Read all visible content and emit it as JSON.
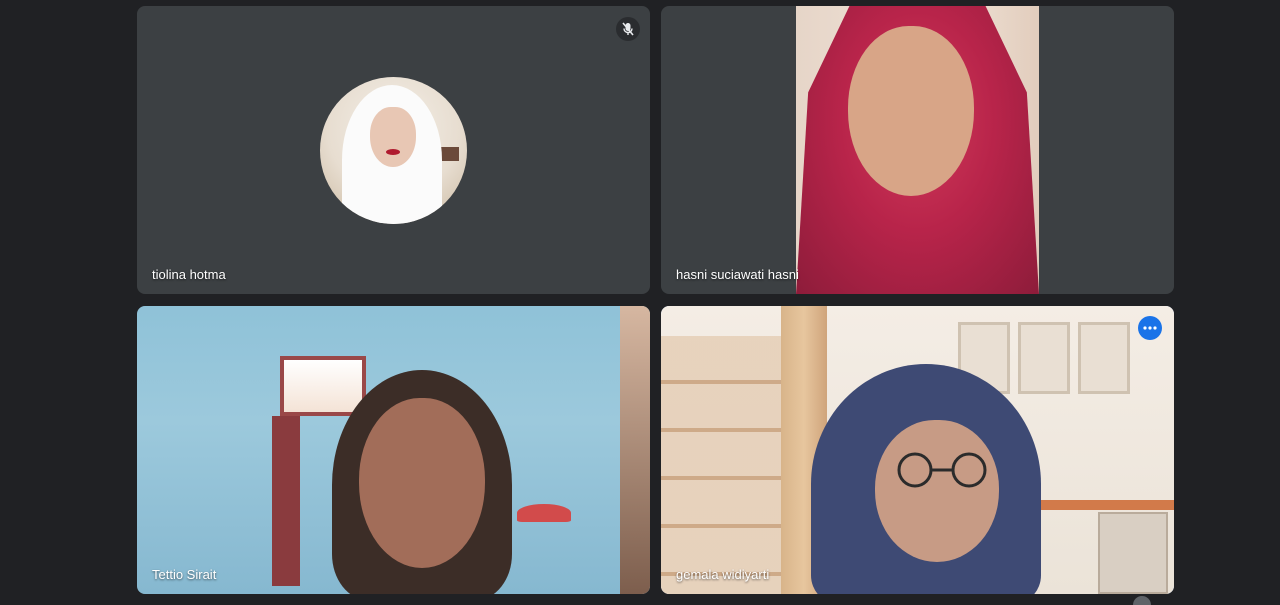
{
  "participants": [
    {
      "name": "tiolina hotma",
      "muted": true,
      "video_on": false
    },
    {
      "name": "hasni suciawati hasni",
      "muted": false,
      "video_on": true
    },
    {
      "name": "Tettio Sirait",
      "muted": false,
      "video_on": true
    },
    {
      "name": "gemala widiyarti",
      "muted": false,
      "video_on": true,
      "active_speaker": true
    }
  ],
  "icons": {
    "mic_off": "mic-off-icon",
    "more": "more-options-icon"
  },
  "colors": {
    "background": "#202124",
    "tile": "#3c4043",
    "active_border": "#8ab4f8",
    "more_button": "#1a73e8"
  }
}
